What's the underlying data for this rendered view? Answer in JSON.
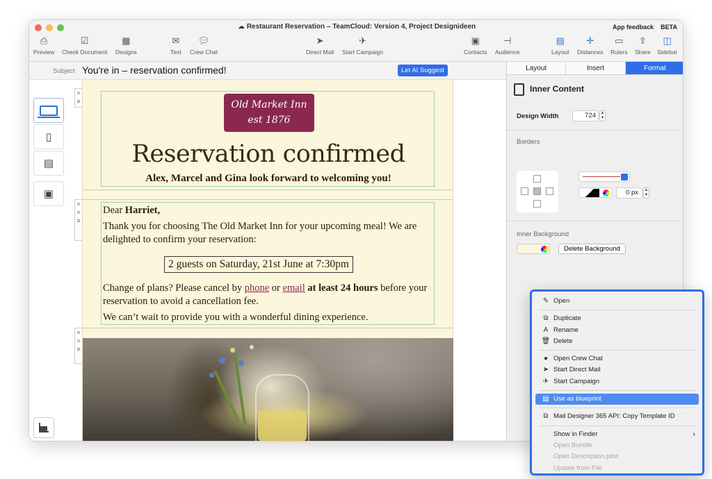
{
  "window": {
    "title": "Restaurant Reservation – TeamCloud: Version 4, Project  Designideen",
    "cloud_icon": "cloud-icon",
    "app_feedback": "App feedback",
    "beta": "BETA"
  },
  "toolbar": {
    "preview": "Preview",
    "check_document": "Check Document",
    "designs": "Designs",
    "test": "Test",
    "crew_chat": "Crew Chat",
    "direct_mail": "Direct Mail",
    "start_campaign": "Start Campaign",
    "contacts": "Contacts",
    "audience": "Audience",
    "layout": "Layout",
    "distances": "Distances",
    "rulers": "Rulers",
    "share": "Share",
    "sidebar": "Sidebar"
  },
  "subject": {
    "label": "Subject",
    "value": "You're in – reservation confirmed!",
    "ai_button": "Let AI Suggest"
  },
  "email": {
    "logo_line1": "Old Market Inn",
    "logo_line2": "est 1876",
    "headline": "Reservation confirmed",
    "subheadline": "Alex, Marcel and Gina look forward to welcoming you!",
    "greeting_prefix": "Dear ",
    "greeting_name": "Harriet,",
    "para1": "Thank you for choosing The Old Market Inn for your upcoming meal! We are delighted to confirm your reservation:",
    "booking": "2 guests on Saturday, 21st June at 7:30pm",
    "para2_a": "Change of plans? Please cancel by ",
    "para2_phone": "phone",
    "para2_or": " or ",
    "para2_email": "email",
    "para2_bold": " at least 24 hours",
    "para2_b": " before your reservation to avoid a cancellation fee.",
    "para3": "We can’t wait to provide you with a wonderful dining experience."
  },
  "panel": {
    "tabs": [
      "Layout",
      "Insert",
      "Format"
    ],
    "active_tab": "Format",
    "heading": "Inner Content",
    "design_width_label": "Design Width",
    "design_width_value": "724",
    "borders_label": "Borders",
    "border_width_value": "0 px",
    "inner_background_label": "Inner Background",
    "delete_background": "Delete Background"
  },
  "context_menu": {
    "items": [
      {
        "label": "Open",
        "icon": "pencil-icon"
      },
      {
        "label": "Duplicate",
        "icon": "duplicate-icon"
      },
      {
        "label": "Rename",
        "icon": "rename-icon"
      },
      {
        "label": "Delete",
        "icon": "trash-icon"
      },
      {
        "label": "Open Crew Chat",
        "icon": "chat-bubble-icon"
      },
      {
        "label": "Start Direct Mail",
        "icon": "paper-plane-icon"
      },
      {
        "label": "Start Campaign",
        "icon": "airplane-icon"
      },
      {
        "label": "Use as blueprint",
        "icon": "blueprint-icon"
      },
      {
        "label": "Mail Designer 365 API: Copy Template ID",
        "icon": "copy-icon"
      },
      {
        "label": "Show in Finder",
        "icon": "chevron-right-icon"
      },
      {
        "label": "Open Bundle"
      },
      {
        "label": "Open Description.plist"
      },
      {
        "label": "Update from File"
      }
    ],
    "highlighted": "Use as blueprint",
    "disabled": [
      "Open Bundle",
      "Open Description.plist",
      "Update from File"
    ]
  },
  "colors": {
    "accent": "#2f6ee8",
    "logo_bg": "#8a2850",
    "email_bg": "#fbf6dc",
    "link": "#8a2850"
  }
}
